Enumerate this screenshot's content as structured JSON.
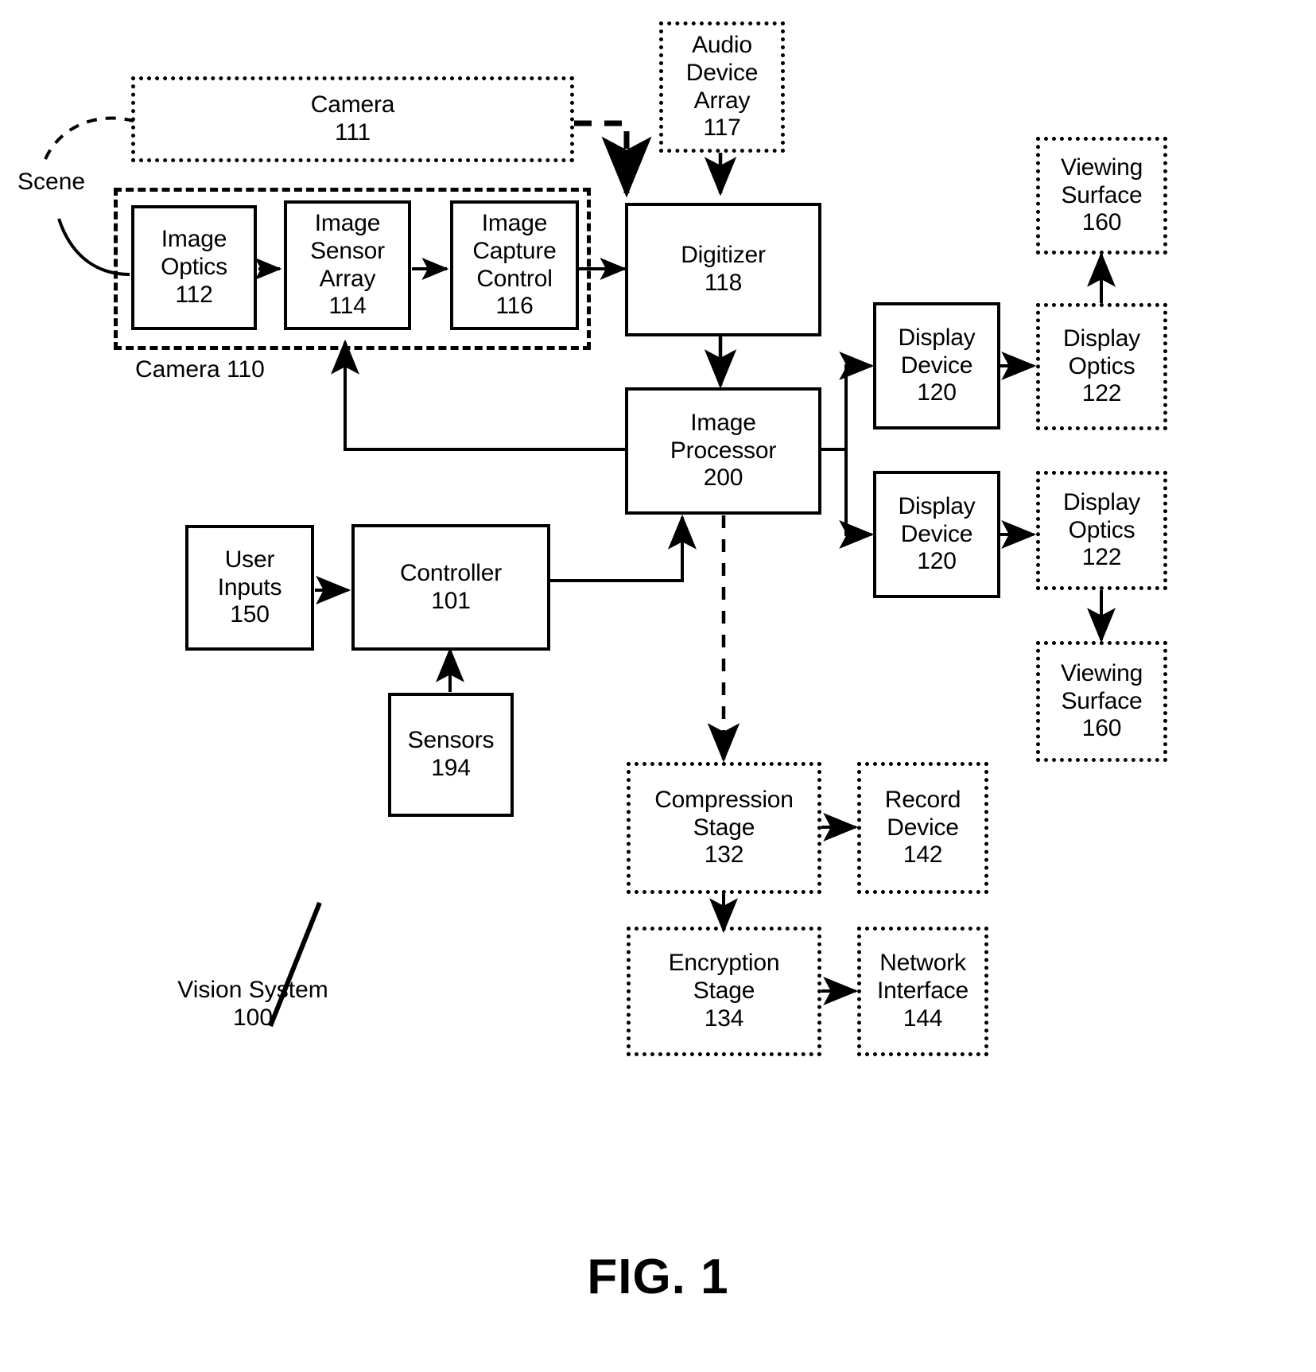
{
  "figure": {
    "caption": "FIG. 1",
    "system_label": {
      "name": "Vision System",
      "number": "100"
    },
    "scene_label": "Scene",
    "camera_group_label": "Camera 110"
  },
  "blocks": {
    "camera111": {
      "lines": [
        "Camera",
        "111"
      ],
      "border": "dotted"
    },
    "audio_device": {
      "lines": [
        "Audio",
        "Device",
        "Array",
        "117"
      ],
      "border": "dotted"
    },
    "image_optics": {
      "lines": [
        "Image",
        "Optics",
        "112"
      ],
      "border": "solid"
    },
    "image_sensor": {
      "lines": [
        "Image",
        "Sensor",
        "Array",
        "114"
      ],
      "border": "solid"
    },
    "image_capture": {
      "lines": [
        "Image",
        "Capture",
        "Control",
        "116"
      ],
      "border": "solid"
    },
    "digitizer": {
      "lines": [
        "Digitizer",
        "118"
      ],
      "border": "solid"
    },
    "image_processor": {
      "lines": [
        "Image",
        "Processor",
        "200"
      ],
      "border": "solid"
    },
    "viewing_surface1": {
      "lines": [
        "Viewing",
        "Surface",
        "160"
      ],
      "border": "dotted"
    },
    "display_device1": {
      "lines": [
        "Display",
        "Device",
        "120"
      ],
      "border": "solid"
    },
    "display_optics1": {
      "lines": [
        "Display",
        "Optics",
        "122"
      ],
      "border": "dotted"
    },
    "display_device2": {
      "lines": [
        "Display",
        "Device",
        "120"
      ],
      "border": "solid"
    },
    "display_optics2": {
      "lines": [
        "Display",
        "Optics",
        "122"
      ],
      "border": "dotted"
    },
    "viewing_surface2": {
      "lines": [
        "Viewing",
        "Surface",
        "160"
      ],
      "border": "dotted"
    },
    "user_inputs": {
      "lines": [
        "User",
        "Inputs",
        "150"
      ],
      "border": "solid"
    },
    "controller": {
      "lines": [
        "Controller",
        "101"
      ],
      "border": "solid"
    },
    "sensors": {
      "lines": [
        "Sensors",
        "194"
      ],
      "border": "solid"
    },
    "compression": {
      "lines": [
        "Compression",
        "Stage",
        "132"
      ],
      "border": "dotted"
    },
    "record_device": {
      "lines": [
        "Record",
        "Device",
        "142"
      ],
      "border": "dotted"
    },
    "encryption": {
      "lines": [
        "Encryption",
        "Stage",
        "134"
      ],
      "border": "dotted"
    },
    "network_interface": {
      "lines": [
        "Network",
        "Interface",
        "144"
      ],
      "border": "dotted"
    }
  },
  "connections": [
    {
      "from": "scene",
      "to": "camera111",
      "style": "dashed-curve"
    },
    {
      "from": "scene",
      "to": "image_optics",
      "style": "solid-curve"
    },
    {
      "from": "camera111",
      "to": "digitizer",
      "style": "dashed"
    },
    {
      "from": "audio_device",
      "to": "digitizer",
      "style": "solid"
    },
    {
      "from": "image_optics",
      "to": "image_sensor",
      "style": "solid"
    },
    {
      "from": "image_sensor",
      "to": "image_capture",
      "style": "solid"
    },
    {
      "from": "image_capture",
      "to": "digitizer",
      "style": "solid"
    },
    {
      "from": "digitizer",
      "to": "image_processor",
      "style": "solid"
    },
    {
      "from": "image_processor",
      "to": "image_sensor",
      "style": "solid"
    },
    {
      "from": "image_processor",
      "to": "display_device1",
      "style": "solid"
    },
    {
      "from": "image_processor",
      "to": "display_device2",
      "style": "solid"
    },
    {
      "from": "display_device1",
      "to": "display_optics1",
      "style": "solid"
    },
    {
      "from": "display_optics1",
      "to": "viewing_surface1",
      "style": "solid"
    },
    {
      "from": "display_device2",
      "to": "display_optics2",
      "style": "solid"
    },
    {
      "from": "display_optics2",
      "to": "viewing_surface2",
      "style": "solid"
    },
    {
      "from": "user_inputs",
      "to": "controller",
      "style": "solid"
    },
    {
      "from": "sensors",
      "to": "controller",
      "style": "solid"
    },
    {
      "from": "controller",
      "to": "image_processor",
      "style": "solid"
    },
    {
      "from": "image_processor",
      "to": "compression",
      "style": "dashed"
    },
    {
      "from": "compression",
      "to": "record_device",
      "style": "solid"
    },
    {
      "from": "compression",
      "to": "encryption",
      "style": "solid"
    },
    {
      "from": "encryption",
      "to": "network_interface",
      "style": "solid"
    }
  ],
  "colors": {
    "ink": "#000000",
    "paper": "#ffffff"
  }
}
